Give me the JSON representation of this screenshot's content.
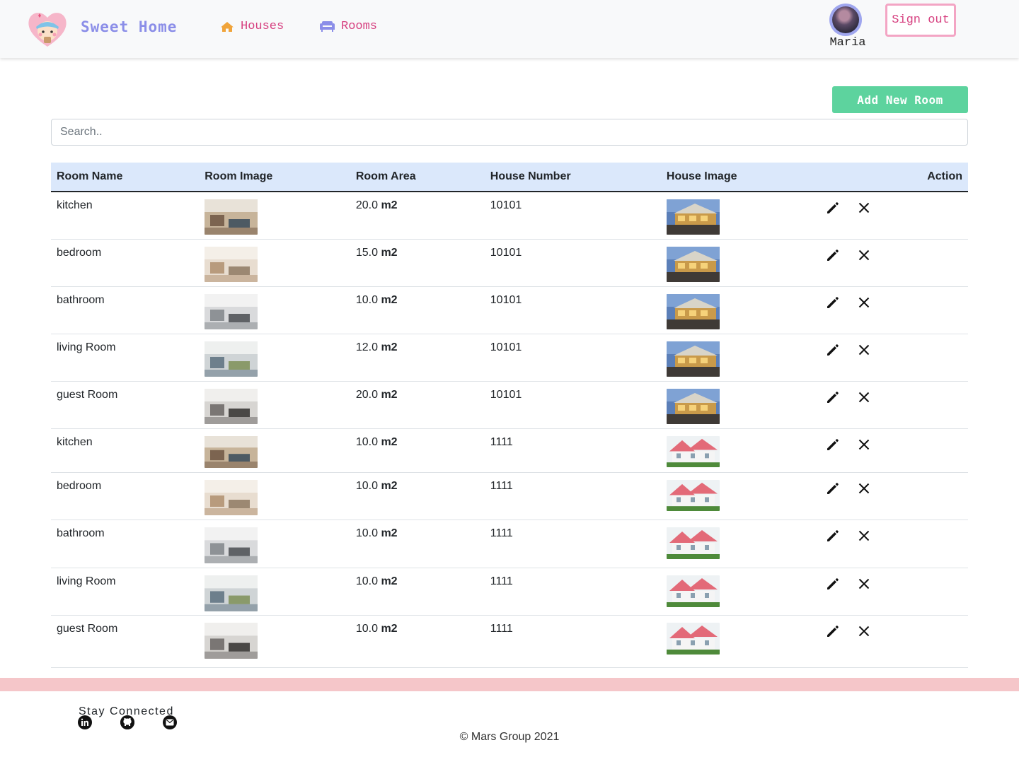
{
  "brand": {
    "name": "Sweet Home",
    "logo_icon": "sweet-home-logo-icon"
  },
  "nav": {
    "houses": {
      "label": "Houses",
      "icon": "home-icon",
      "color": "#f0a43a"
    },
    "rooms": {
      "label": "Rooms",
      "icon": "sofa-icon",
      "color": "#8b8ee8"
    }
  },
  "user": {
    "name": "Maria",
    "signout_label": "Sign out"
  },
  "main": {
    "add_button_label": "Add New Room",
    "search_placeholder": "Search..",
    "columns": [
      "Room Name",
      "Room Image",
      "Room Area",
      "House Number",
      "House Image",
      "Action"
    ],
    "area_unit": "m2",
    "rows": [
      {
        "name": "kitchen",
        "area": "20.0",
        "house_number": "10101",
        "room_image": "kitchen-photo",
        "house_image": "house-10101-photo"
      },
      {
        "name": "bedroom",
        "area": "15.0",
        "house_number": "10101",
        "room_image": "bedroom-photo",
        "house_image": "house-10101-photo"
      },
      {
        "name": "bathroom",
        "area": "10.0",
        "house_number": "10101",
        "room_image": "bathroom-photo",
        "house_image": "house-10101-photo"
      },
      {
        "name": "living Room",
        "area": "12.0",
        "house_number": "10101",
        "room_image": "living-room-photo",
        "house_image": "house-10101-photo"
      },
      {
        "name": "guest Room",
        "area": "20.0",
        "house_number": "10101",
        "room_image": "guest-room-photo",
        "house_image": "house-10101-photo"
      },
      {
        "name": "kitchen",
        "area": "10.0",
        "house_number": "1111",
        "room_image": "kitchen-photo",
        "house_image": "house-1111-photo"
      },
      {
        "name": "bedroom",
        "area": "10.0",
        "house_number": "1111",
        "room_image": "bedroom-photo",
        "house_image": "house-1111-photo"
      },
      {
        "name": "bathroom",
        "area": "10.0",
        "house_number": "1111",
        "room_image": "bathroom-photo",
        "house_image": "house-1111-photo"
      },
      {
        "name": "living Room",
        "area": "10.0",
        "house_number": "1111",
        "room_image": "living-room-photo",
        "house_image": "house-1111-photo"
      },
      {
        "name": "guest Room",
        "area": "10.0",
        "house_number": "1111",
        "room_image": "guest-room-photo",
        "house_image": "house-1111-photo"
      }
    ],
    "action_icons": [
      "pencil-icon",
      "close-icon"
    ]
  },
  "footer": {
    "stay_connected": "Stay Connected",
    "social_icons": [
      "linkedin-icon",
      "github-icon",
      "email-icon"
    ],
    "copyright": "© Mars Group 2021"
  },
  "colors": {
    "accent_pink": "#d63f7f",
    "signout_border": "#f3a5c4",
    "add_button": "#5dd39e",
    "table_header": "#dbe8fb",
    "footer_bar": "#f5c6c9",
    "brand": "#8b8ee8"
  }
}
